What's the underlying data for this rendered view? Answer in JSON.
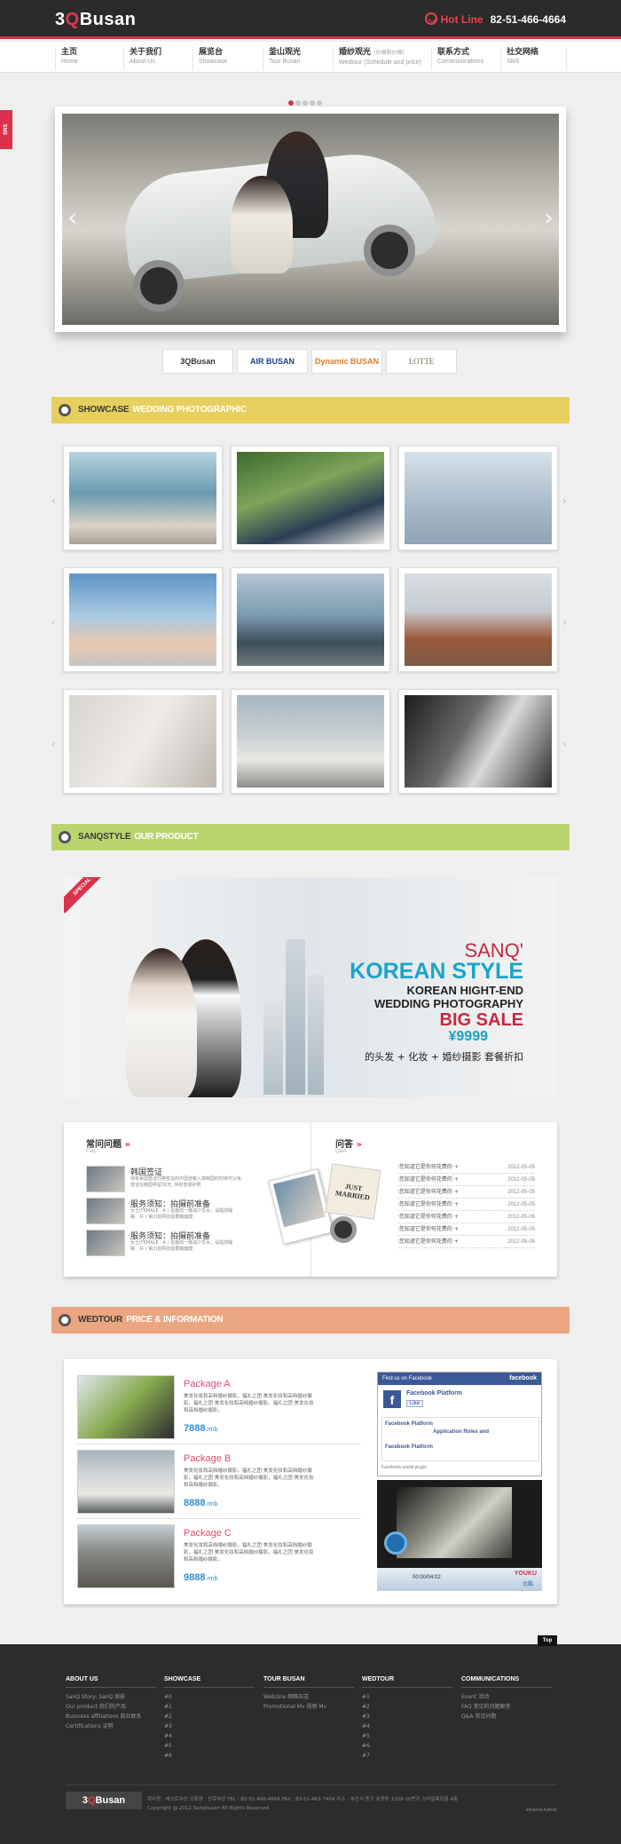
{
  "header": {
    "logo_prefix": "3",
    "logo_q": "Q",
    "logo_suffix": "Busan",
    "hotline_label": "Hot Line",
    "hotline_number": "82-51-466-4664"
  },
  "nav": [
    {
      "zh": "主页",
      "en": "Home"
    },
    {
      "zh": "关于我们",
      "en": "About Us"
    },
    {
      "zh": "展览台",
      "en": "Showcase"
    },
    {
      "zh": "釜山观光",
      "en": "Tour Busan"
    },
    {
      "zh": "婚纱观光",
      "zh_small": "(价格和价格)",
      "en": "Wedtour (Schedule and price)"
    },
    {
      "zh": "联系方式",
      "en": "Communications"
    },
    {
      "zh": "社交网络",
      "en": "SNS"
    }
  ],
  "sns_tab": "SNS",
  "partners": [
    {
      "name": "3QBusan",
      "color": "#333333"
    },
    {
      "name": "AIR BUSAN",
      "color": "#1d3f8c"
    },
    {
      "name": "Dynamic BUSAN",
      "color": "#e07a1e"
    },
    {
      "name": "LOTTE",
      "color": "#7a6a55"
    }
  ],
  "sections": {
    "showcase": {
      "bold": "SHOWCASE",
      "light": "WEDDING PHOTOGRAPHIC",
      "color": "#e6cf5f"
    },
    "product": {
      "bold": "SANQSTYLE",
      "light": "OUR PRODUCT",
      "color": "#b9d46f"
    },
    "wedtour": {
      "bold": "WEDTOUR",
      "light": "PRICE & INFORMATION",
      "color": "#eaa680"
    }
  },
  "banner": {
    "special": "SPECIAL",
    "line1": "SANQ'",
    "line2": "KOREAN STYLE",
    "line3": "KOREAN HIGHT-END",
    "line4": "WEDDING PHOTOGRAPHY",
    "line5": "BIG SALE",
    "price": "¥9999",
    "subline": "的头发 + 化妆 + 婚纱摄影 套餐折扣"
  },
  "faq": {
    "title": "常问问题",
    "sub": "Faq",
    "items": [
      {
        "title": "韩国签证",
        "desc": "持有美国签证同等签证的中国游客入境韩国的时候可以免签证在韩国停留30天, 持有普通护照"
      },
      {
        "title": "服务须知：拍摄前准备",
        "desc": "女士(FEMALE : A ) 拍摄前一晚减少饮水，请提前睡眠，并 ( 第2)拍照前需要做面膜"
      },
      {
        "title": "服务须知：拍摄前准备",
        "desc": "女士(FEMALE : A ) 拍摄前一晚减少饮水，请提前睡眠，并 ( 第2)拍照前需要做面膜"
      }
    ]
  },
  "qa": {
    "title": "问答",
    "sub": "Q&A",
    "rows": [
      {
        "q": "·您知道它是你何花费的 +",
        "date": "2012-05-05"
      },
      {
        "q": "·您知道它是你何花费的 +",
        "date": "2012-05-05"
      },
      {
        "q": "·您知道它是你何花费的 +",
        "date": "2012-05-05"
      },
      {
        "q": "·您知道它是你何花费的 +",
        "date": "2012-05-05"
      },
      {
        "q": "·您知道它是你何花费的 +",
        "date": "2012-05-05"
      },
      {
        "q": "·您知道它是你何花费的 +",
        "date": "2012-05-05"
      },
      {
        "q": "·您知道它是你何花费的 +",
        "date": "2012-05-05"
      }
    ],
    "sticker": "JUST MARRIED"
  },
  "packages": [
    {
      "name": "Package A",
      "desc": "美发化妆和高档婚纱摄影，福礼之团 美发化妆和高档婚纱摄影，福礼之团 美发化妆和高档婚纱摄影，福礼之团 美发化妆和高档婚纱摄影，",
      "price": "7888",
      "unit": ".rmb"
    },
    {
      "name": "Package B",
      "desc": "美发化妆和高档婚纱摄影，福礼之团 美发化妆和高档婚纱摄影，福礼之团 美发化妆和高档婚纱摄影，福礼之团 美发化妆和高档婚纱摄影，",
      "price": "8888",
      "unit": ".rmb"
    },
    {
      "name": "Package C",
      "desc": "美发化妆和高档婚纱摄影，福礼之团 美发化妆和高档婚纱摄影，福礼之团 美发化妆和高档婚纱摄影，福礼之团 美发化妆和高档婚纱摄影，",
      "price": "9888",
      "unit": ".rmb"
    }
  ],
  "facebook": {
    "find": "Find us on Facebook",
    "brand": "facebook",
    "page": "Facebook Platform",
    "like": "Like",
    "post1": "Facebook Platform",
    "post2": "Application Roles and",
    "post3": "Facebook Platform",
    "plugin": "Facebook social plugin"
  },
  "video": {
    "brand": "YOUKU",
    "brand_sub": "优酷",
    "time": "00:00/04:02"
  },
  "footer": {
    "top": "Top",
    "cols": [
      {
        "h": "ABOUT US",
        "items": [
          "SanQ Story: SanQ 原影",
          "Our product 我们的产品",
          "Business affiliations 商业联系",
          "Certifications 证明"
        ]
      },
      {
        "h": "SHOWCASE",
        "items": [
          "#0",
          "#1",
          "#2",
          "#3",
          "#4",
          "#5",
          "#6"
        ]
      },
      {
        "h": "TOUR BUSAN",
        "items": [
          "Webzine 网络杂志",
          "Promotional Mv 视频 Mv"
        ]
      },
      {
        "h": "WEDTOUR",
        "items": [
          "#1",
          "#2",
          "#3",
          "#4",
          "#5",
          "#6",
          "#7"
        ]
      },
      {
        "h": "COMMUNICATIONS",
        "items": [
          "Event 活动",
          "FAQ 常见的问题解答",
          "Q&A 常见问题"
        ]
      }
    ],
    "logo_prefix": "3",
    "logo_q": "Q",
    "logo_suffix": "Busan",
    "info": "회사명 : 쌔스트부산    상표명 : 산큐부산    TEL : 82-51-466-4664    FAX : 82-51-463-7404    주소 : 부산시 동구 초량동 1209-10번지 스타일웨딩홀 4층",
    "copyright": "Copyright @ 2012 Sanqbusan All Rights Reserved.",
    "links": "Intranet   Admin"
  }
}
